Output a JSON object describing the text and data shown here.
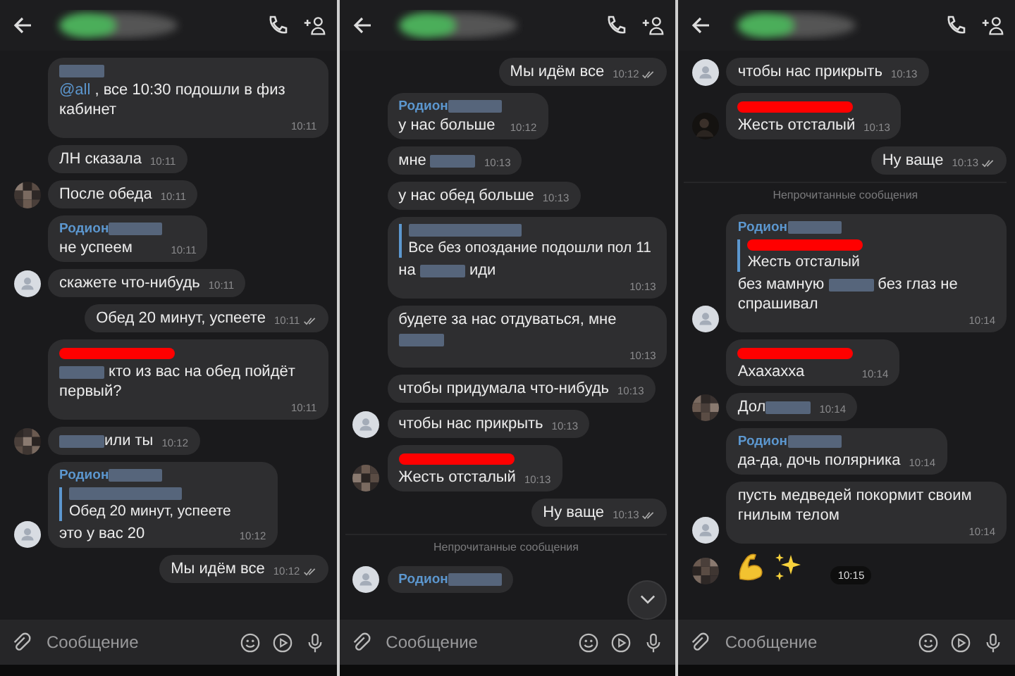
{
  "panels": [
    {
      "input": {
        "placeholder": "Сообщение"
      },
      "messages": [
        {
          "kind": "in",
          "sender": [
            {
              "kind": "blur"
            }
          ],
          "parts": [
            {
              "kind": "mention",
              "text": "@all"
            },
            {
              "kind": "text",
              "text": " , все 10:30 подошли в физ кабинет"
            }
          ],
          "time": "10:11"
        },
        {
          "kind": "in",
          "parts": [
            {
              "kind": "text",
              "text": "ЛН сказала"
            }
          ],
          "time": "10:11"
        },
        {
          "kind": "in",
          "avatar": {
            "kind": "pixel"
          },
          "parts": [
            {
              "kind": "text",
              "text": "После обеда"
            }
          ],
          "time": "10:11"
        },
        {
          "kind": "in",
          "sender": [
            {
              "kind": "name",
              "text": "Родион"
            },
            {
              "kind": "blur"
            }
          ],
          "parts": [
            {
              "kind": "text",
              "text": "не успеем"
            }
          ],
          "time": "10:11"
        },
        {
          "kind": "in",
          "avatar": {
            "kind": "default"
          },
          "parts": [
            {
              "kind": "text",
              "text": "скажете что-нибудь"
            }
          ],
          "time": "10:11"
        },
        {
          "kind": "out",
          "parts": [
            {
              "kind": "text",
              "text": "Обед 20 минут, успеете"
            }
          ],
          "time": "10:11",
          "read": true
        },
        {
          "kind": "in",
          "sender": [
            {
              "kind": "red"
            }
          ],
          "parts": [
            {
              "kind": "blur"
            },
            {
              "kind": "text",
              "text": " кто из вас на обед пойдёт первый?"
            }
          ],
          "time": "10:11"
        },
        {
          "kind": "in",
          "avatar": {
            "kind": "pixel"
          },
          "parts": [
            {
              "kind": "blur"
            },
            {
              "kind": "text",
              "text": "или ты"
            }
          ],
          "time": "10:12"
        },
        {
          "kind": "in",
          "avatar": {
            "kind": "default"
          },
          "sender": [
            {
              "kind": "name",
              "text": "Родион"
            },
            {
              "kind": "blur"
            }
          ],
          "quote": {
            "author": [
              {
                "kind": "blur"
              }
            ],
            "text": "Обед 20 минут, успеете"
          },
          "parts": [
            {
              "kind": "text",
              "text": "это у вас 20"
            }
          ],
          "time": "10:12"
        },
        {
          "kind": "out",
          "parts": [
            {
              "kind": "text",
              "text": "Мы идём все"
            }
          ],
          "time": "10:12",
          "read": true
        }
      ]
    },
    {
      "input": {
        "placeholder": "Сообщение"
      },
      "scroll_button": true,
      "messages": [
        {
          "kind": "out",
          "parts": [
            {
              "kind": "text",
              "text": "Мы идём все"
            }
          ],
          "time": "10:12",
          "read": true
        },
        {
          "kind": "in",
          "sender": [
            {
              "kind": "name",
              "text": "Родион"
            },
            {
              "kind": "blur"
            }
          ],
          "parts": [
            {
              "kind": "text",
              "text": "у нас больше"
            }
          ],
          "time": "10:12"
        },
        {
          "kind": "in",
          "parts": [
            {
              "kind": "text",
              "text": "мне "
            },
            {
              "kind": "blur"
            }
          ],
          "time": "10:13"
        },
        {
          "kind": "in",
          "parts": [
            {
              "kind": "text",
              "text": "у нас обед больше"
            }
          ],
          "time": "10:13"
        },
        {
          "kind": "in",
          "quote": {
            "author": [
              {
                "kind": "blur"
              }
            ],
            "text": "Все без опоздание подошли пол 11"
          },
          "parts": [
            {
              "kind": "text",
              "text": "на "
            },
            {
              "kind": "blur"
            },
            {
              "kind": "text",
              "text": " иди"
            }
          ],
          "time": "10:13"
        },
        {
          "kind": "in",
          "parts": [
            {
              "kind": "text",
              "text": "будете за нас отдуваться, мне "
            },
            {
              "kind": "blur"
            }
          ],
          "time": "10:13"
        },
        {
          "kind": "in",
          "parts": [
            {
              "kind": "text",
              "text": "чтобы придумала что-нибудь"
            }
          ],
          "time": "10:13"
        },
        {
          "kind": "in",
          "avatar": {
            "kind": "default"
          },
          "parts": [
            {
              "kind": "text",
              "text": "чтобы нас прикрыть"
            }
          ],
          "time": "10:13"
        },
        {
          "kind": "in",
          "avatar": {
            "kind": "pixel"
          },
          "sender": [
            {
              "kind": "red"
            }
          ],
          "parts": [
            {
              "kind": "text",
              "text": "Жесть отсталый"
            }
          ],
          "time": "10:13"
        },
        {
          "kind": "out",
          "parts": [
            {
              "kind": "text",
              "text": "Ну ваще"
            }
          ],
          "time": "10:13",
          "read": true
        },
        {
          "kind": "divider",
          "text": "Непрочитанные сообщения"
        },
        {
          "kind": "in",
          "avatar": {
            "kind": "default"
          },
          "sender": [
            {
              "kind": "name",
              "text": "Родион"
            },
            {
              "kind": "blur"
            }
          ]
        }
      ]
    },
    {
      "input": {
        "placeholder": "Сообщение"
      },
      "messages": [
        {
          "kind": "in",
          "avatar": {
            "kind": "default"
          },
          "parts": [
            {
              "kind": "text",
              "text": "чтобы нас прикрыть"
            }
          ],
          "time": "10:13"
        },
        {
          "kind": "in",
          "avatar": {
            "kind": "dark"
          },
          "sender": [
            {
              "kind": "red"
            }
          ],
          "parts": [
            {
              "kind": "text",
              "text": "Жесть отсталый"
            }
          ],
          "time": "10:13"
        },
        {
          "kind": "out",
          "parts": [
            {
              "kind": "text",
              "text": "Ну ваще"
            }
          ],
          "time": "10:13",
          "read": true
        },
        {
          "kind": "divider",
          "text": "Непрочитанные сообщения"
        },
        {
          "kind": "in",
          "avatar": {
            "kind": "default"
          },
          "sender": [
            {
              "kind": "name",
              "text": "Родион"
            },
            {
              "kind": "blur"
            }
          ],
          "quote": {
            "author": [
              {
                "kind": "red"
              }
            ],
            "text": "Жесть отсталый"
          },
          "parts": [
            {
              "kind": "text",
              "text": "без мамную "
            },
            {
              "kind": "blur"
            },
            {
              "kind": "text",
              "text": " без глаз не спрашивал"
            }
          ],
          "time": "10:14"
        },
        {
          "kind": "in",
          "sender": [
            {
              "kind": "red"
            }
          ],
          "parts": [
            {
              "kind": "text",
              "text": "Ахахахха"
            }
          ],
          "time": "10:14"
        },
        {
          "kind": "in",
          "avatar": {
            "kind": "pixel"
          },
          "parts": [
            {
              "kind": "text",
              "text": "Дол"
            },
            {
              "kind": "blur"
            }
          ],
          "time": "10:14"
        },
        {
          "kind": "in",
          "sender": [
            {
              "kind": "name",
              "text": "Родион"
            },
            {
              "kind": "blur"
            }
          ],
          "parts": [
            {
              "kind": "text",
              "text": "да-да, дочь полярника"
            }
          ],
          "time": "10:14"
        },
        {
          "kind": "in",
          "avatar": {
            "kind": "default"
          },
          "parts": [
            {
              "kind": "text",
              "text": "пусть медведей покормит своим гнилым телом"
            }
          ],
          "time": "10:14"
        },
        {
          "kind": "sticker",
          "avatar": {
            "kind": "pixel"
          },
          "time": "10:15"
        }
      ]
    }
  ]
}
